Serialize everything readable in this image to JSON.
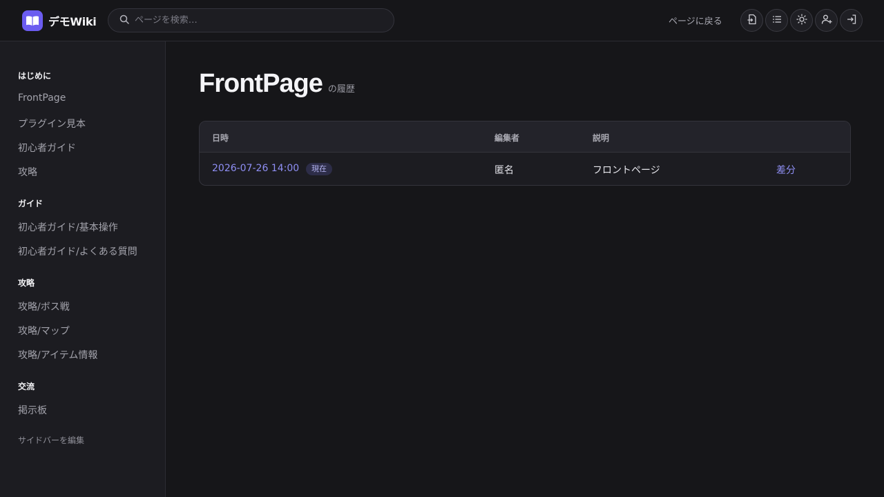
{
  "header": {
    "brand_name": "デモWiki",
    "search_placeholder": "ページを検索…",
    "back_label": "ページに戻る",
    "actions": [
      {
        "icon": "page-import-icon"
      },
      {
        "icon": "list-icon"
      },
      {
        "icon": "sun-icon"
      },
      {
        "icon": "user-add-icon"
      },
      {
        "icon": "login-icon"
      }
    ]
  },
  "sidebar": {
    "sections": [
      {
        "heading": "はじめに",
        "items": [
          "FrontPage",
          "プラグイン見本",
          "初心者ガイド",
          "攻略"
        ]
      },
      {
        "heading": "ガイド",
        "items": [
          "初心者ガイド/基本操作",
          "初心者ガイド/よくある質問"
        ]
      },
      {
        "heading": "攻略",
        "items": [
          "攻略/ボス戦",
          "攻略/マップ",
          "攻略/アイテム情報"
        ]
      },
      {
        "heading": "交流",
        "items": [
          "掲示板"
        ]
      }
    ],
    "edit_label": "サイドバーを編集"
  },
  "main": {
    "title": "FrontPage",
    "title_suffix": "の履歴",
    "table": {
      "headers": [
        "日時",
        "編集者",
        "説明"
      ],
      "rows": [
        {
          "datetime": "2026-07-26 14:00",
          "badge": "現在",
          "editor": "匿名",
          "description": "フロントページ",
          "action": "差分"
        }
      ]
    }
  },
  "colors": {
    "accent": "#6b5cf0",
    "link": "#8f8ff5",
    "background": "#161619",
    "sidebar_background": "#1c1c21"
  }
}
